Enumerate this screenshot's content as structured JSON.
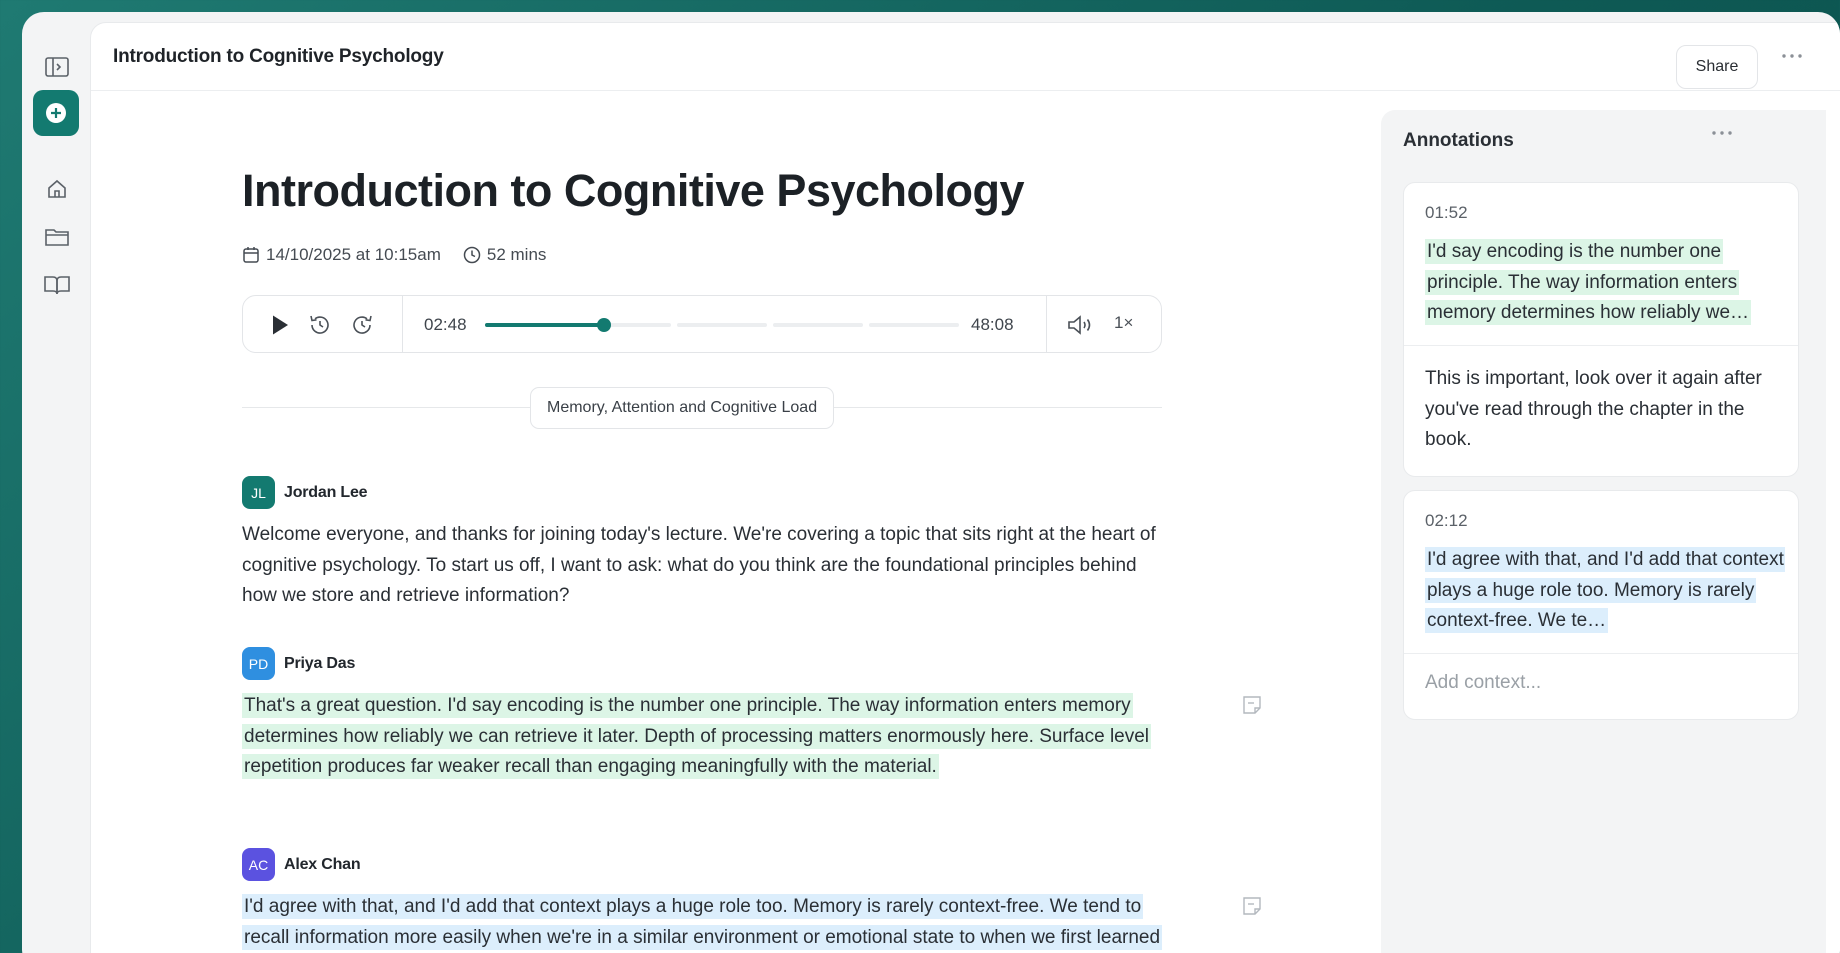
{
  "app": {
    "page_title": "Introduction to Cognitive Psychology",
    "share_label": "Share"
  },
  "rail": {
    "icons": [
      "sidebar-toggle-icon",
      "new-item-icon",
      "home-icon",
      "folder-icon",
      "book-icon"
    ]
  },
  "document": {
    "title": "Introduction to Cognitive Psychology",
    "date": "14/10/2025 at 10:15am",
    "duration": "52 mins"
  },
  "player": {
    "current_time": "02:48",
    "total_time": "48:08",
    "progress": 0.25,
    "speed": "1×"
  },
  "section": {
    "label": "Memory, Attention and Cognitive Load"
  },
  "transcript": [
    {
      "initials": "JL",
      "name": "Jordan Lee",
      "color": "#137a70",
      "text": "Welcome everyone, and thanks for joining today's lecture. We're covering a topic that sits right at the heart of cognitive psychology. To start us off, I want to ask: what do you think are the foundational principles behind how we store and retrieve information?"
    },
    {
      "initials": "PD",
      "name": "Priya Das",
      "color": "#2f8fe0",
      "highlight": "#dcf5e6",
      "text": "That's a great question. I'd say encoding is the number one principle. The way information enters memory determines how reliably we can retrieve it later. Depth of processing matters enormously here. Surface level repetition produces far weaker recall than engaging meaningfully with the material."
    },
    {
      "initials": "AC",
      "name": "Alex Chan",
      "color": "#5b52e0",
      "highlight": "#dceefc",
      "text": "I'd agree with that, and I'd add that context plays a huge role too. Memory is rarely context-free. We tend to recall information more easily when we're in a similar environment or emotional state to when we first learned it. That has real implications for how students approach revision."
    }
  ],
  "annotations": {
    "title": "Annotations",
    "items": [
      {
        "time": "01:52",
        "quote": "I'd say encoding is the number one principle. The way information enters memory determines how reliably we…",
        "note": "This is important, look over it again after you've read through the chapter in the book."
      },
      {
        "time": "02:12",
        "quote": "I'd agree with that, and I'd add that context plays a huge role too. Memory is rarely context-free. We te…",
        "placeholder": "Add context..."
      }
    ]
  },
  "tools": [
    "pen-icon",
    "bookmark-icon",
    "checkbox-icon",
    "attachment-icon",
    "clipboard-icon"
  ]
}
